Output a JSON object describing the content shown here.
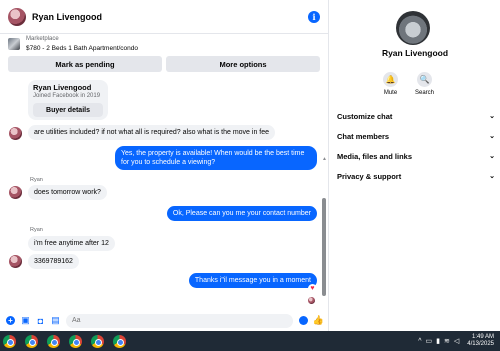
{
  "header": {
    "name": "Ryan Livengood"
  },
  "listing": {
    "label": "Marketplace",
    "title": "$780 - 2 Beds 1 Bath Apartment/condo"
  },
  "actions": {
    "mark_pending": "Mark as pending",
    "more_options": "More options"
  },
  "profile_card": {
    "name": "Ryan Livengood",
    "joined": "Joined Facebook in 2019",
    "button": "Buyer details"
  },
  "messages": [
    {
      "from": "in",
      "text": "are utilities included? if not what all is required? also what is the move in fee"
    },
    {
      "from": "out",
      "text": "Yes, the property is available! When would be the best time for you to schedule a viewing?"
    },
    {
      "from": "in",
      "sender": "Ryan",
      "text": "does tomorrow work?"
    },
    {
      "from": "out",
      "text": "Ok, Please can you me your contact number"
    },
    {
      "from": "in",
      "sender": "Ryan",
      "text": "i'm free anytime after 12"
    },
    {
      "from": "in",
      "text": "3369789162"
    },
    {
      "from": "out",
      "text": "Thanks i\"il message you in a moment"
    }
  ],
  "composer": {
    "placeholder": "Aa"
  },
  "side": {
    "name": "Ryan Livengood",
    "mute": "Mute",
    "search": "Search",
    "menu": [
      "Customize chat",
      "Chat members",
      "Media, files and links",
      "Privacy & support"
    ]
  },
  "taskbar": {
    "time": "1:49 AM",
    "date": "4/13/2025"
  },
  "colors": {
    "accent": "#0866ff",
    "bubble_in": "#f0f2f5",
    "taskbar": "#1f2a36"
  }
}
